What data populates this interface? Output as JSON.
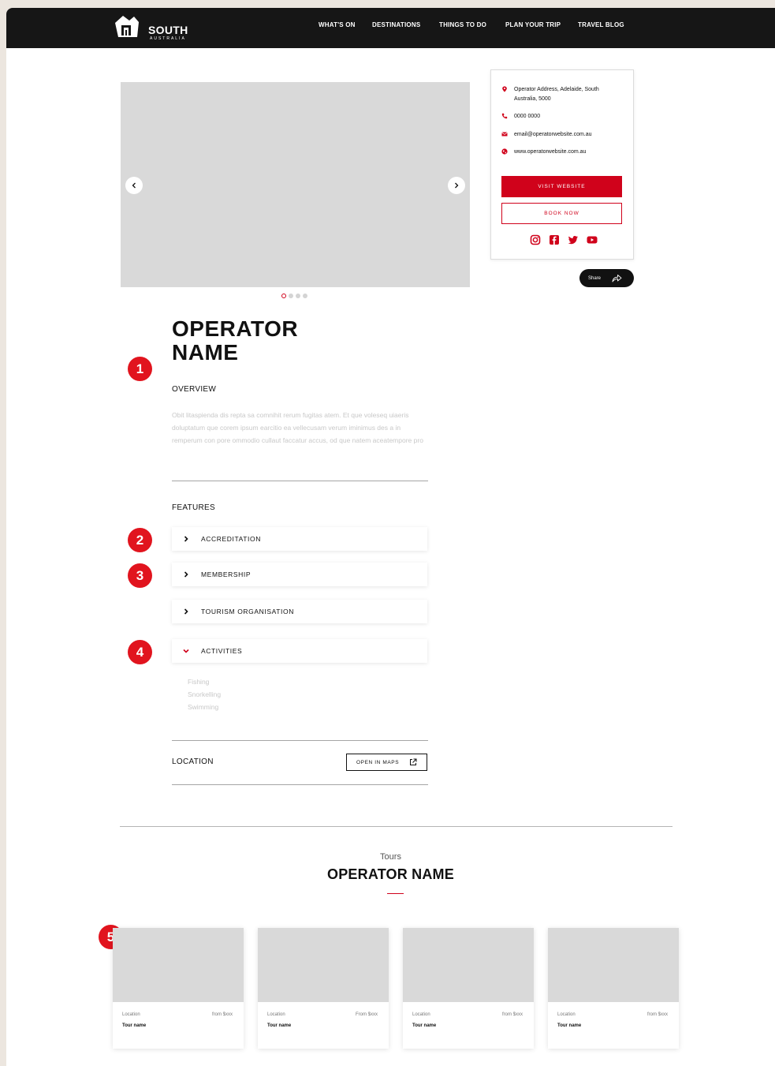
{
  "header": {
    "logo_text": "SOUTH",
    "logo_sub": "AUSTRALIA",
    "nav": [
      "WHAT'S ON",
      "DESTINATIONS",
      "THINGS TO DO",
      "PLAN YOUR TRIP",
      "TRAVEL BLOG"
    ]
  },
  "contact": {
    "address": "Operator Address, Adelaide, South Australia, 5000",
    "phone": "0000 0000",
    "email": "email@operatorwebsite.com.au",
    "website": "www.operatorwebsite.com.au",
    "visit_label": "VISIT WEBSITE",
    "book_label": "BOOK NOW",
    "socials": [
      "instagram-icon",
      "facebook-icon",
      "twitter-icon",
      "youtube-icon"
    ],
    "share_label": "Share"
  },
  "gallery": {
    "slide_count": 4,
    "active_index": 0
  },
  "badges": [
    "1",
    "2",
    "3",
    "4",
    "5"
  ],
  "operator": {
    "name": "OPERATOR\nNAME",
    "overview_heading": "OVERVIEW",
    "overview_text": "Obit litaspienda dis repta sa comnihit rerum fugitas atem. Et que voleseq uiaeris doluptatum que corem ipsum earcitio ea vellecusam verum iminimus des a in remperum con pore ommodio cullaut faccatur accus, od que natem aceatempore pro",
    "features_heading": "FEATURES",
    "features": [
      {
        "label": "ACCREDITATION",
        "expanded": false
      },
      {
        "label": "MEMBERSHIP",
        "expanded": false
      },
      {
        "label": "TOURISM ORGANISATION",
        "expanded": false
      },
      {
        "label": "ACTIVITIES",
        "expanded": true
      }
    ],
    "activities": [
      "Fishing",
      "Snorkelling",
      "Swimming"
    ],
    "location_heading": "LOCATION",
    "maps_label": "OPEN IN MAPS"
  },
  "tours": {
    "subtitle": "Tours",
    "title": "OPERATOR NAME",
    "cards": [
      {
        "location": "Location",
        "price": "from $xxx",
        "name": "Tour name"
      },
      {
        "location": "Location",
        "price": "From $xxx",
        "name": "Tour name"
      },
      {
        "location": "Location",
        "price": "from $xxx",
        "name": "Tour name"
      },
      {
        "location": "Location",
        "price": "from $xxx",
        "name": "Tour name"
      }
    ]
  },
  "colors": {
    "accent": "#d0021b",
    "badge": "#e1141e",
    "nav_bg": "#161616",
    "placeholder": "#d9d9d9"
  }
}
